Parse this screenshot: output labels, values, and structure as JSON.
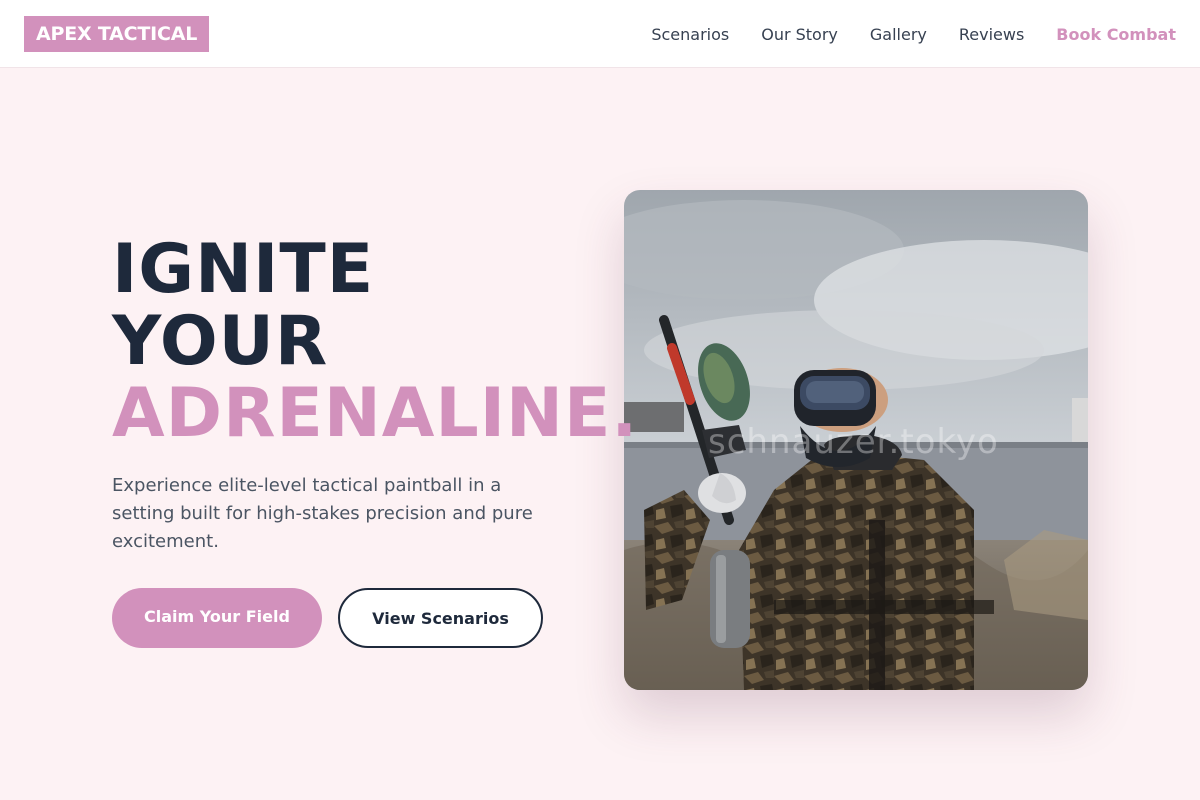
{
  "brand": {
    "name": "APEX TACTICAL",
    "accent": "#d291bc",
    "dark": "#1e293b",
    "background": "#fdf2f4"
  },
  "nav": {
    "links": [
      {
        "label": "Scenarios"
      },
      {
        "label": "Our Story"
      },
      {
        "label": "Gallery"
      },
      {
        "label": "Reviews"
      }
    ],
    "cta": "Book Combat"
  },
  "hero": {
    "title_line1": "IGNITE",
    "title_line2": "YOUR",
    "title_accent": "ADRENALINE.",
    "subtitle": "Experience elite-level tactical paintball in a setting built for high-stakes precision and pure excitement.",
    "primary_button": "Claim Your Field",
    "secondary_button": "View Scenarios",
    "image": {
      "subject": "paintball player in camouflage holding a paintball marker",
      "watermark": "schnauzer.tokyo"
    }
  }
}
